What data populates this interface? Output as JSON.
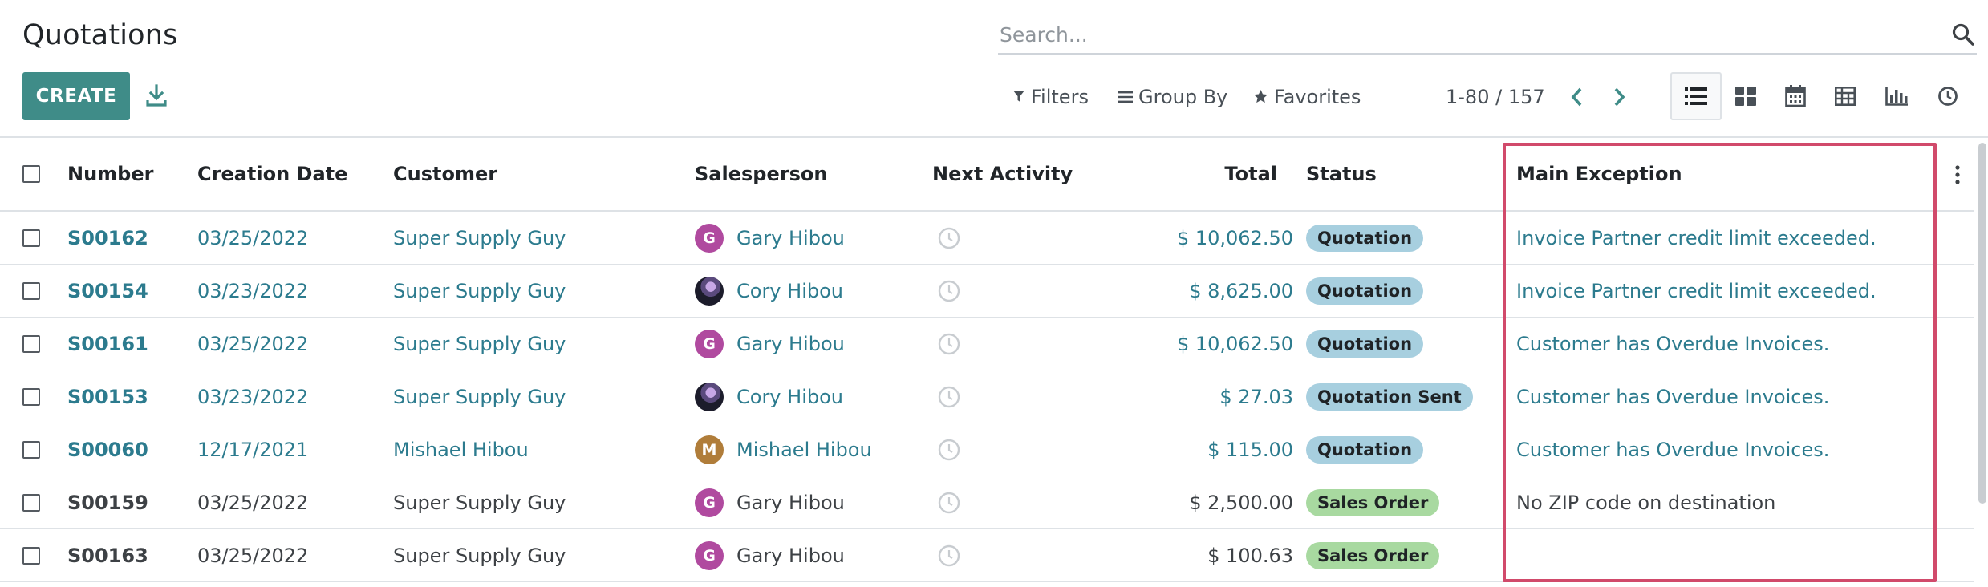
{
  "header": {
    "title": "Quotations",
    "create_label": "CREATE",
    "search_placeholder": "Search...",
    "filters_label": "Filters",
    "groupby_label": "Group By",
    "favorites_label": "Favorites",
    "pager_text": "1-80 / 157"
  },
  "views": [
    "list-view-icon",
    "kanban-view-icon",
    "calendar-view-icon",
    "pivot-view-icon",
    "graph-view-icon",
    "activity-view-icon"
  ],
  "colors": {
    "accent": "#3f8c88",
    "link": "#2c7b8e",
    "quotation_badge": "#a7cfdf",
    "sales_order_badge": "#a8d9a0",
    "highlight_border": "#d14a6b"
  },
  "table": {
    "columns": {
      "number": "Number",
      "creation_date": "Creation Date",
      "customer": "Customer",
      "salesperson": "Salesperson",
      "next_activity": "Next Activity",
      "total": "Total",
      "status": "Status",
      "main_exception": "Main Exception"
    },
    "rows": [
      {
        "number": "S00162",
        "date": "03/25/2022",
        "customer": "Super Supply Guy",
        "salesperson": "Gary Hibou",
        "avatar": "G",
        "avatar_color": "#b04a9f",
        "total": "$ 10,062.50",
        "status": "Quotation",
        "exception": "Invoice Partner credit limit exceeded.",
        "linked": true
      },
      {
        "number": "S00154",
        "date": "03/23/2022",
        "customer": "Super Supply Guy",
        "salesperson": "Cory Hibou",
        "avatar": "",
        "avatar_color": "",
        "total": "$ 8,625.00",
        "status": "Quotation",
        "exception": "Invoice Partner credit limit exceeded.",
        "linked": true
      },
      {
        "number": "S00161",
        "date": "03/25/2022",
        "customer": "Super Supply Guy",
        "salesperson": "Gary Hibou",
        "avatar": "G",
        "avatar_color": "#b04a9f",
        "total": "$ 10,062.50",
        "status": "Quotation",
        "exception": "Customer has Overdue Invoices.",
        "linked": true
      },
      {
        "number": "S00153",
        "date": "03/23/2022",
        "customer": "Super Supply Guy",
        "salesperson": "Cory Hibou",
        "avatar": "",
        "avatar_color": "",
        "total": "$ 27.03",
        "status": "Quotation Sent",
        "exception": "Customer has Overdue Invoices.",
        "linked": true
      },
      {
        "number": "S00060",
        "date": "12/17/2021",
        "customer": "Mishael Hibou",
        "salesperson": "Mishael Hibou",
        "avatar": "M",
        "avatar_color": "#b07d3a",
        "total": "$ 115.00",
        "status": "Quotation",
        "exception": "Customer has Overdue Invoices.",
        "linked": true
      },
      {
        "number": "S00159",
        "date": "03/25/2022",
        "customer": "Super Supply Guy",
        "salesperson": "Gary Hibou",
        "avatar": "G",
        "avatar_color": "#b04a9f",
        "total": "$ 2,500.00",
        "status": "Sales Order",
        "exception": "No ZIP code on destination",
        "linked": false
      },
      {
        "number": "S00163",
        "date": "03/25/2022",
        "customer": "Super Supply Guy",
        "salesperson": "Gary Hibou",
        "avatar": "G",
        "avatar_color": "#b04a9f",
        "total": "$ 100.63",
        "status": "Sales Order",
        "exception": "",
        "linked": false
      }
    ]
  }
}
